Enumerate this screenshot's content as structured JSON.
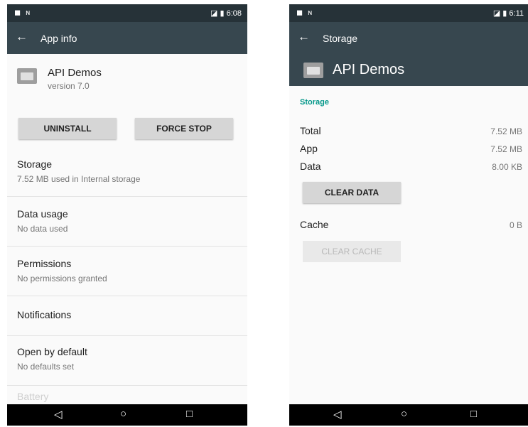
{
  "left": {
    "status": {
      "left_icons": "◼ ɴ",
      "right": "◪ ▮ 6:08"
    },
    "appbar": {
      "back": "←",
      "title": "App info"
    },
    "app": {
      "name": "API Demos",
      "version": "version 7.0"
    },
    "buttons": {
      "uninstall": "UNINSTALL",
      "force_stop": "FORCE STOP"
    },
    "prefs": [
      {
        "title": "Storage",
        "summary": "7.52 MB used in Internal storage"
      },
      {
        "title": "Data usage",
        "summary": "No data used"
      },
      {
        "title": "Permissions",
        "summary": "No permissions granted"
      },
      {
        "title": "Notifications",
        "summary": ""
      },
      {
        "title": "Open by default",
        "summary": "No defaults set"
      },
      {
        "title": "Battery",
        "summary": ""
      }
    ],
    "nav": {
      "back": "◁",
      "home": "○",
      "recents": "□"
    }
  },
  "right": {
    "status": {
      "left_icons": "◼ ɴ",
      "right": "◪ ▮ 6:11"
    },
    "appbar": {
      "back": "←",
      "title": "Storage"
    },
    "app_name": "API Demos",
    "section_header": "Storage",
    "rows": [
      {
        "label": "Total",
        "value": "7.52 MB"
      },
      {
        "label": "App",
        "value": "7.52 MB"
      },
      {
        "label": "Data",
        "value": "8.00 KB"
      }
    ],
    "clear_data": "CLEAR DATA",
    "cache": {
      "label": "Cache",
      "value": "0 B"
    },
    "clear_cache": "CLEAR CACHE",
    "nav": {
      "back": "◁",
      "home": "○",
      "recents": "□"
    }
  },
  "colors": {
    "toolbar": "#37474f",
    "statusbar": "#263238",
    "accent": "#009688",
    "navbar": "#000000"
  },
  "icons": [
    "back-arrow-icon",
    "folder-app-icon",
    "nav-back-icon",
    "nav-home-icon",
    "nav-recents-icon",
    "signal-icon",
    "battery-icon"
  ]
}
